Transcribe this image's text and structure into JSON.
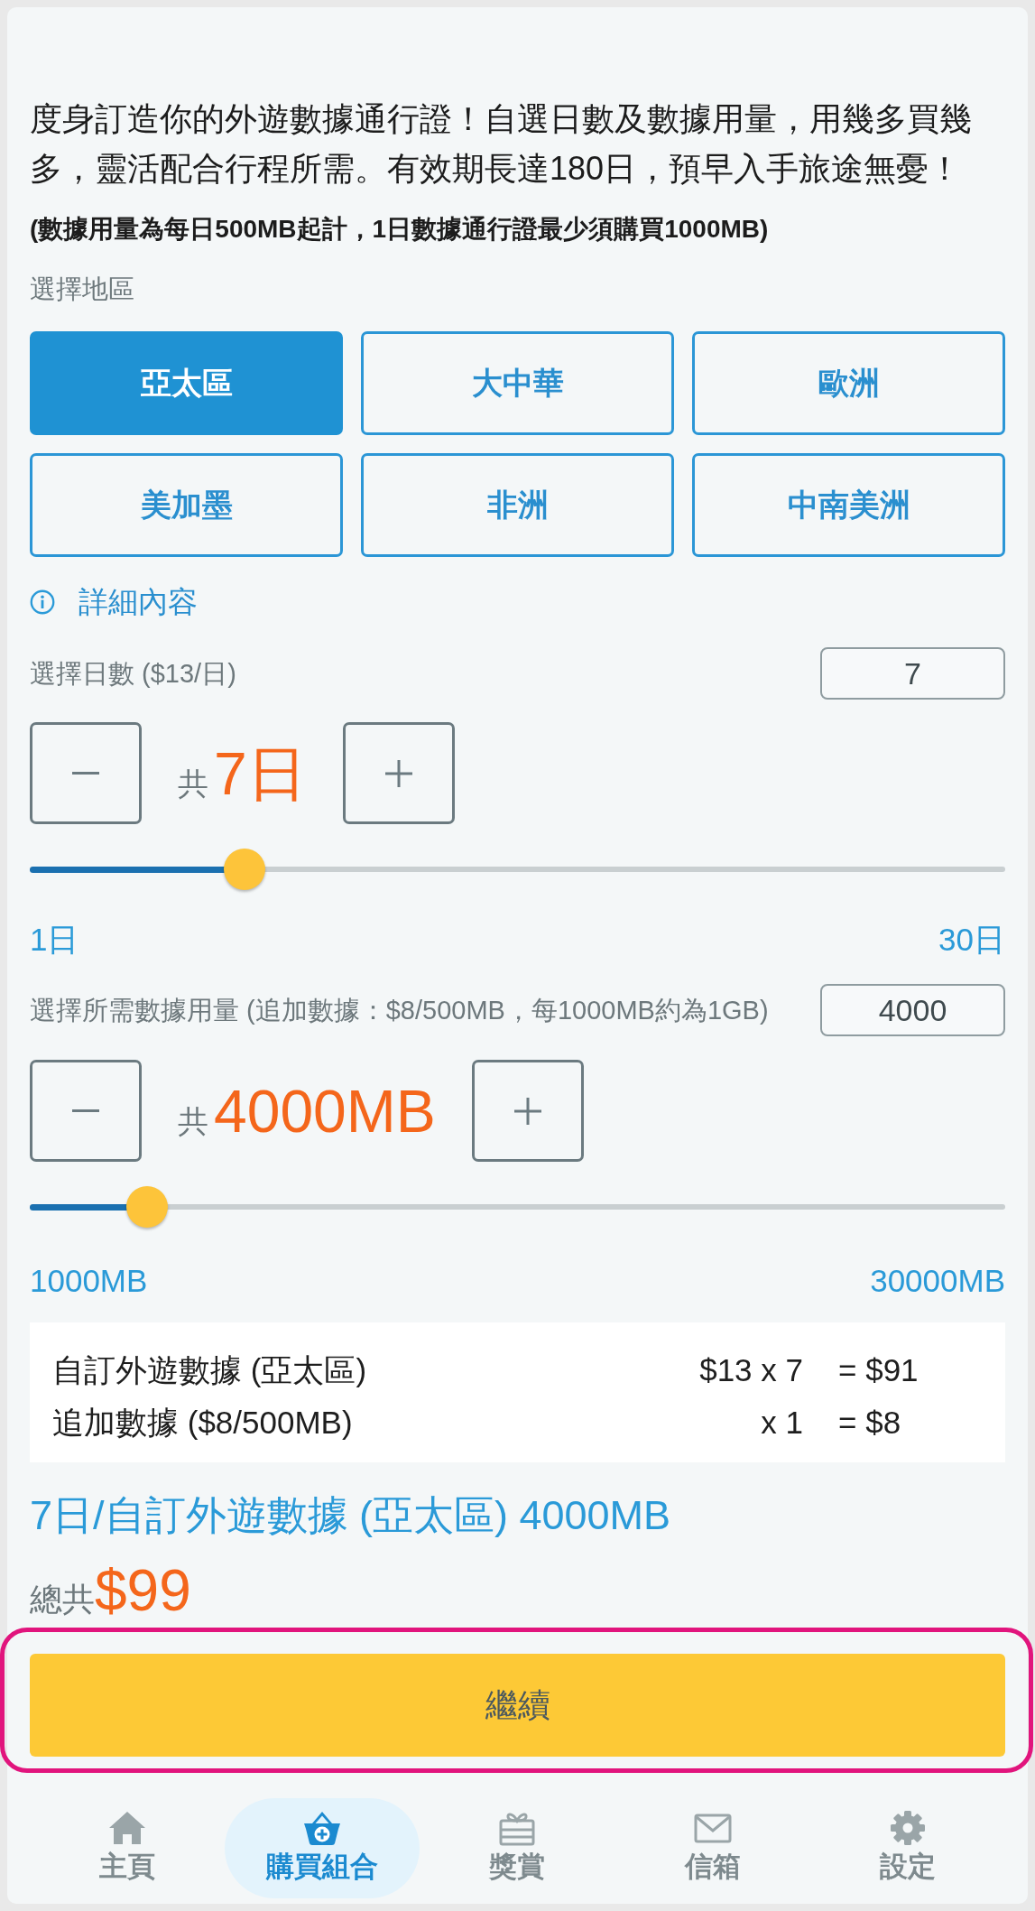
{
  "intro": "度身訂造你的外遊數據通行證！自選日數及數據用量，用幾多買幾多，靈活配合行程所需。有效期長達180日，預早入手旅途無憂！",
  "note": "(數據用量為每日500MB起計，1日數據通行證最少須購買1000MB)",
  "region_label": "選擇地區",
  "regions": [
    {
      "label": "亞太區",
      "selected": true
    },
    {
      "label": "大中華",
      "selected": false
    },
    {
      "label": "歐洲",
      "selected": false
    },
    {
      "label": "美加墨",
      "selected": false
    },
    {
      "label": "非洲",
      "selected": false
    },
    {
      "label": "中南美洲",
      "selected": false
    }
  ],
  "details_link": "詳細內容",
  "days": {
    "label": "選擇日數 ($13/日)",
    "value": "7",
    "total_prefix": "共",
    "total": "7日",
    "level": 0.22,
    "min_label": "1日",
    "max_label": "30日"
  },
  "data": {
    "label": "選擇所需數據用量 (追加數據：$8/500MB，每1000MB約為1GB)",
    "value": "4000",
    "total_prefix": "共",
    "total": "4000MB",
    "level": 0.12,
    "min_label": "1000MB",
    "max_label": "30000MB"
  },
  "breakdown": [
    {
      "item": "自訂外遊數據 (亞太區)",
      "quantity": "$13 x 7",
      "amount": "= $91"
    },
    {
      "item": "追加數據 ($8/500MB)",
      "quantity": "x 1",
      "amount": "= $8"
    }
  ],
  "summary": "7日/自訂外遊數據 (亞太區) 4000MB",
  "total": {
    "label": "總共",
    "amount": "$99"
  },
  "continue_button": {
    "label": "繼續",
    "highlighted": true
  },
  "nav": [
    {
      "kind": "home",
      "label": "主頁",
      "selected": false
    },
    {
      "kind": "basket",
      "label": "購買組合",
      "selected": true
    },
    {
      "kind": "gift",
      "label": "獎賞",
      "selected": false
    },
    {
      "kind": "mail",
      "label": "信箱",
      "selected": false
    },
    {
      "kind": "settings",
      "label": "設定",
      "selected": false
    }
  ]
}
